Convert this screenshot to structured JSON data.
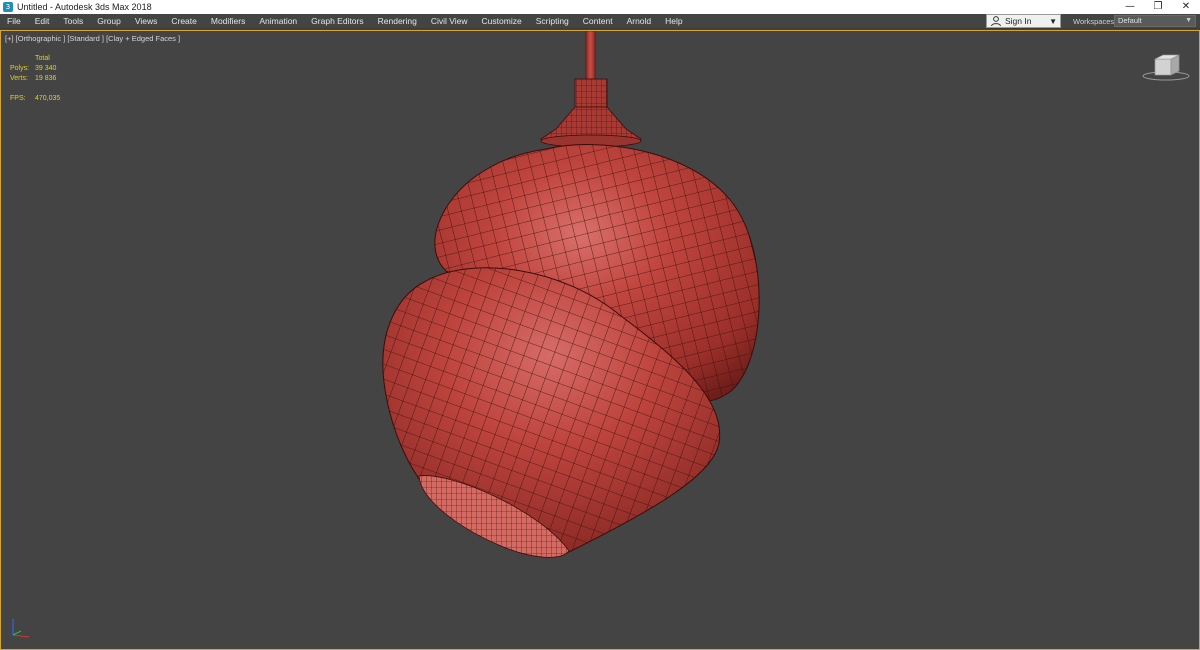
{
  "window": {
    "title": "Untitled - Autodesk 3ds Max 2018",
    "app_icon": "3ds-max-icon",
    "controls": {
      "minimize": "—",
      "restore": "❐",
      "close": "✕"
    }
  },
  "menubar": {
    "items": [
      "File",
      "Edit",
      "Tools",
      "Group",
      "Views",
      "Create",
      "Modifiers",
      "Animation",
      "Graph Editors",
      "Rendering",
      "Civil View",
      "Customize",
      "Scripting",
      "Content",
      "Arnold",
      "Help"
    ]
  },
  "account": {
    "signin_label": "Sign In"
  },
  "workspaces": {
    "label": "Workspaces:",
    "value": "Default"
  },
  "viewport": {
    "label": "[+] [Orthographic ] [Standard ] [Clay + Edged Faces ]",
    "stats": {
      "header": "Total",
      "polys_label": "Polys:",
      "polys_value": "39 340",
      "verts_label": "Verts:",
      "verts_value": "19 836",
      "fps_label": "FPS:",
      "fps_value": "470,035"
    },
    "colors": {
      "border": "#d6a62a",
      "stats_text": "#e3d21a",
      "clay": "#b8423b",
      "wire": "#3a0d0b",
      "background": "#444444"
    }
  }
}
